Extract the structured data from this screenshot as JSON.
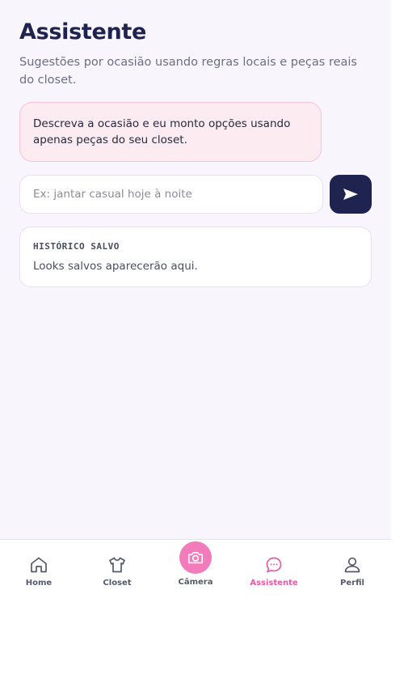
{
  "page": {
    "title": "Assistente",
    "subtitle": "Sugestões por ocasião usando regras locais e peças reais do closet."
  },
  "assistant_message": "Descreva a ocasião e eu monto opções usando apenas peças do seu closet.",
  "prompt": {
    "placeholder": "Ex: jantar casual hoje à noite",
    "value": ""
  },
  "send_icon": "send-icon",
  "history": {
    "title": "HISTÓRICO SALVO",
    "empty_text": "Looks salvos aparecerão aqui."
  },
  "nav": {
    "items": [
      {
        "label": "Home",
        "icon": "home-icon"
      },
      {
        "label": "Closet",
        "icon": "shirt-icon"
      },
      {
        "label": "Câmera",
        "icon": "camera-icon"
      },
      {
        "label": "Assistente",
        "icon": "chat-icon",
        "active": true
      },
      {
        "label": "Perfil",
        "icon": "user-icon"
      }
    ]
  },
  "colors": {
    "background": "#f9f5fd",
    "title": "#1e2350",
    "accent_pink": "#e85ba4",
    "camera_button": "#f27bbb",
    "send_button": "#1e2350",
    "bubble_bg": "#fdebf2",
    "bubble_border": "#f7c3d6"
  }
}
